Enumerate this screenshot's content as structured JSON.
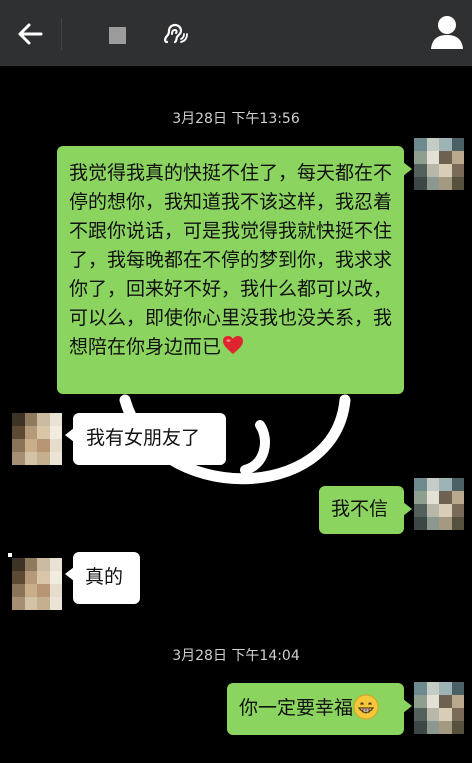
{
  "header": {
    "back_icon": "arrow-left-icon",
    "voice_icon": "ear-icon",
    "profile_icon": "person-icon",
    "bar_color": "#2f3032"
  },
  "messages": {
    "timestamp_1": "3月28日 下午13:56",
    "msg_1": "我觉得我真的快挺不住了，每天都在不停的想你，我知道我不该这样，我忍着不跟你说话，可是我觉得我就快挺不住了，我每晚都在不停的梦到你，我求求你了，回来好不好，我什么都可以改，可以么，即使你心里没我也没关系，我想陪在你身边而已",
    "msg_1_emoji": "red-heart",
    "msg_2": "我有女朋友了",
    "msg_3": "我不信",
    "msg_4": "真的",
    "timestamp_2": "3月28日 下午14:04",
    "msg_5": "你一定要幸福",
    "msg_5_emoji": "grinning-face"
  },
  "colors": {
    "outgoing_bubble": "#8bd460",
    "incoming_bubble": "#ffffff",
    "background": "#000000",
    "timestamp_text": "#cfcfcf"
  }
}
